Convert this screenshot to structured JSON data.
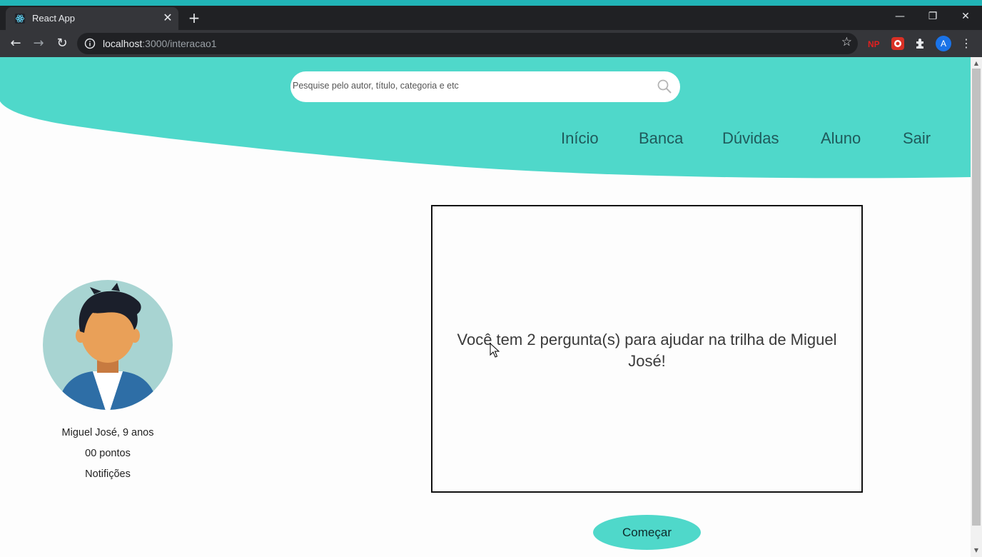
{
  "browser": {
    "tab_title": "React App",
    "url_host": "localhost",
    "url_path": ":3000/interacao1",
    "avatar_letter": "A",
    "ext_np_label": "NP"
  },
  "search": {
    "placeholder": "Pesquise pelo autor, título, categoria e etc"
  },
  "nav": {
    "items": [
      {
        "label": "Início"
      },
      {
        "label": "Banca"
      },
      {
        "label": "Dúvidas"
      },
      {
        "label": "Aluno"
      },
      {
        "label": "Sair"
      }
    ]
  },
  "profile": {
    "name_age": "Miguel José, 9 anos",
    "points": "00 pontos",
    "notifications": "Notifições"
  },
  "question_box": {
    "line1": "Você tem 2 pergunta(s) para ajudar na trilha de Miguel",
    "line2": "José!"
  },
  "start_button": {
    "label": "Começar"
  },
  "colors": {
    "accent": "#4fd8ca",
    "nav_text": "#1f5a5b",
    "chrome_dark": "#202124",
    "chrome_mid": "#35363a"
  }
}
